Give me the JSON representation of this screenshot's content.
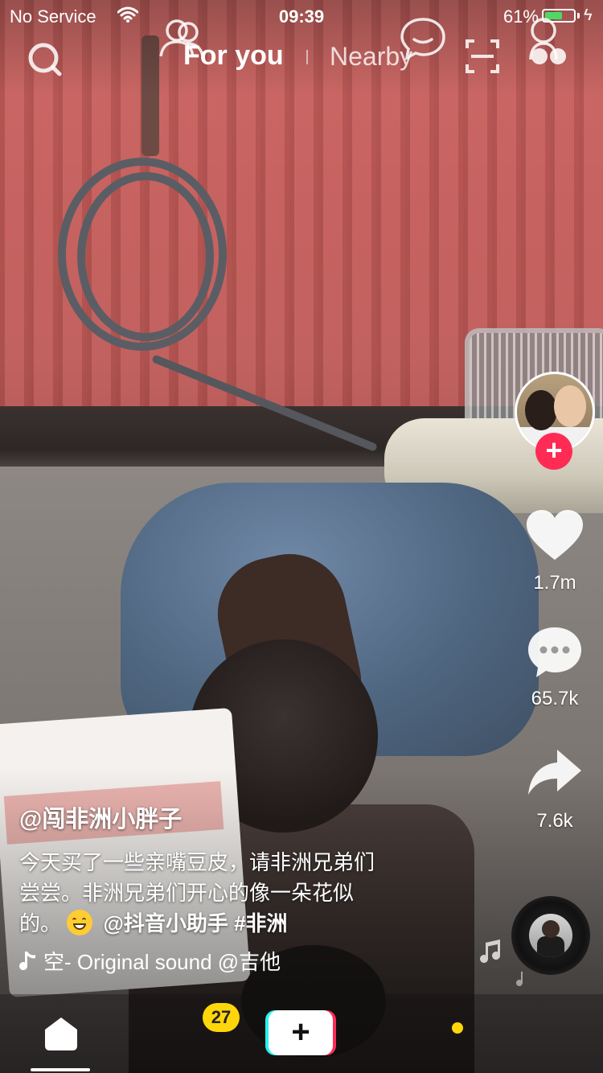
{
  "status_bar": {
    "carrier": "No Service",
    "time": "09:39",
    "battery_percent": "61%",
    "battery_level": 0.61,
    "battery_color": "#4cd964"
  },
  "top_nav": {
    "tabs": [
      {
        "label": "For you",
        "active": true
      },
      {
        "label": "Nearby",
        "active": false
      }
    ],
    "icons": [
      "search-icon",
      "scan-icon",
      "live-icon"
    ]
  },
  "video": {
    "username": "@闯非洲小胖子",
    "description_line1": "今天买了一些亲嘴豆皮，请非洲兄弟们",
    "description_line2": "尝尝。非洲兄弟们开心的像一朵花似",
    "description_line3_prefix": "的。",
    "mention": "@抖音小助手",
    "hashtag": "#非洲",
    "sound": "空- Original sound    @吉他"
  },
  "actions": {
    "likes": "1.7m",
    "comments": "65.7k",
    "shares": "7.6k",
    "follow_label": "+"
  },
  "bottom_nav": {
    "items": [
      "home-icon",
      "friends-icon",
      "create-button",
      "inbox-icon",
      "profile-icon"
    ],
    "friends_badge": "27",
    "create_label": "+",
    "accent_colors": {
      "cyan": "#25f4ee",
      "red": "#fe2c55",
      "badge": "#ffd60a"
    }
  }
}
